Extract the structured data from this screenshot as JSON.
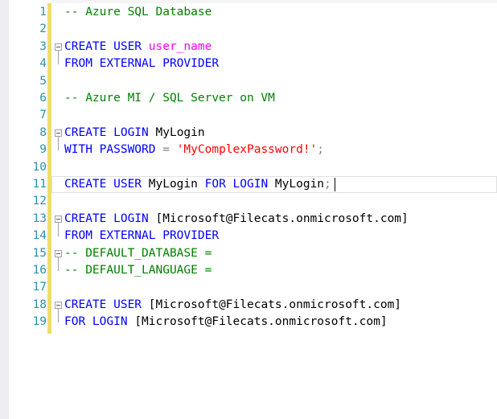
{
  "editor": {
    "lines": [
      {
        "num": "1",
        "tokens": [
          {
            "t": "-- Azure SQL Database",
            "c": "cm"
          }
        ]
      },
      {
        "num": "2",
        "tokens": []
      },
      {
        "num": "3",
        "fold": true,
        "tokens": [
          {
            "t": "CREATE USER ",
            "c": "kw"
          },
          {
            "t": "user_name",
            "c": "mg"
          }
        ]
      },
      {
        "num": "4",
        "tokens": [
          {
            "t": "FROM EXTERNAL PROVIDER",
            "c": "kw"
          }
        ]
      },
      {
        "num": "5",
        "tokens": []
      },
      {
        "num": "6",
        "tokens": [
          {
            "t": "-- Azure MI / SQL Server on VM",
            "c": "cm"
          }
        ]
      },
      {
        "num": "7",
        "tokens": []
      },
      {
        "num": "8",
        "fold": true,
        "tokens": [
          {
            "t": "CREATE LOGIN ",
            "c": "kw"
          },
          {
            "t": "MyLogin",
            "c": "tx"
          }
        ]
      },
      {
        "num": "9",
        "tokens": [
          {
            "t": "WITH PASSWORD ",
            "c": "kw"
          },
          {
            "t": "= ",
            "c": "gr"
          },
          {
            "t": "'MyComplexPassword!'",
            "c": "st"
          },
          {
            "t": ";",
            "c": "gr"
          }
        ]
      },
      {
        "num": "10",
        "tokens": []
      },
      {
        "num": "11",
        "current": true,
        "tokens": [
          {
            "t": "CREATE USER ",
            "c": "kw"
          },
          {
            "t": "MyLogin ",
            "c": "tx"
          },
          {
            "t": "FOR LOGIN ",
            "c": "kw"
          },
          {
            "t": "MyLogin",
            "c": "tx"
          },
          {
            "t": ";",
            "c": "gr"
          }
        ]
      },
      {
        "num": "12",
        "tokens": []
      },
      {
        "num": "13",
        "fold": true,
        "tokens": [
          {
            "t": "CREATE LOGIN ",
            "c": "kw"
          },
          {
            "t": "[Microsoft@Filecats.onmicrosoft.com]",
            "c": "tx"
          }
        ]
      },
      {
        "num": "14",
        "tokens": [
          {
            "t": "FROM EXTERNAL PROVIDER",
            "c": "kw"
          }
        ]
      },
      {
        "num": "15",
        "fold": true,
        "tokens": [
          {
            "t": "-- DEFAULT_DATABASE =",
            "c": "cm"
          }
        ]
      },
      {
        "num": "16",
        "tokens": [
          {
            "t": "-- DEFAULT_LANGUAGE =",
            "c": "cm"
          }
        ]
      },
      {
        "num": "17",
        "tokens": []
      },
      {
        "num": "18",
        "fold": true,
        "tokens": [
          {
            "t": "CREATE USER ",
            "c": "kw"
          },
          {
            "t": "[Microsoft@Filecats.onmicrosoft.com]",
            "c": "tx"
          }
        ]
      },
      {
        "num": "19",
        "tokens": [
          {
            "t": "FOR LOGIN ",
            "c": "kw"
          },
          {
            "t": "[Microsoft@Filecats.onmicrosoft.com]",
            "c": "tx"
          }
        ]
      }
    ],
    "colors": {
      "keyword": "#0000ff",
      "comment": "#008000",
      "string": "#ff0000",
      "variable": "#ff00ff",
      "operator": "#808080",
      "line_number": "#2b91af",
      "change_bar": "#f0dc6c"
    }
  }
}
